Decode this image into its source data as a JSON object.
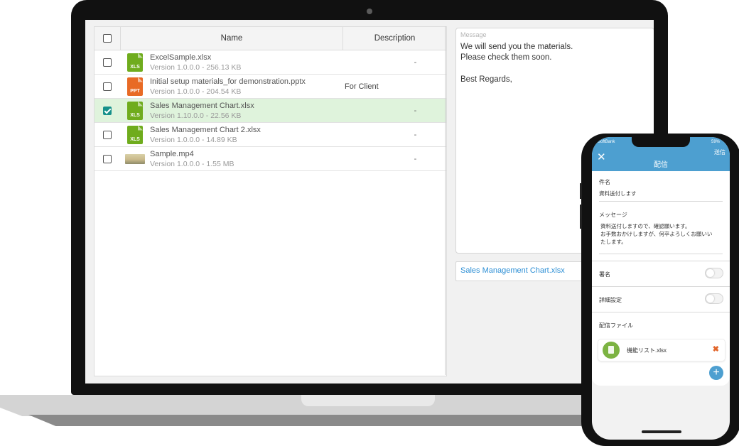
{
  "table": {
    "headers": {
      "name": "Name",
      "description": "Description"
    },
    "rows": [
      {
        "icon": "xls-file-icon",
        "icon_label": "XLS",
        "name": "ExcelSample.xlsx",
        "meta": "Version 1.0.0.0 - 256.13 KB",
        "description": "-",
        "checked": false
      },
      {
        "icon": "ppt-file-icon",
        "icon_label": "PPT",
        "name": "Initial setup materials_for demonstration.pptx",
        "meta": "Version 1.0.0.0 - 204.54 KB",
        "description": "For Client",
        "checked": false
      },
      {
        "icon": "xls-file-icon",
        "icon_label": "XLS",
        "name": "Sales Management Chart.xlsx",
        "meta": "Version 1.10.0.0 - 22.56 KB",
        "description": "-",
        "checked": true
      },
      {
        "icon": "xls-file-icon",
        "icon_label": "XLS",
        "name": "Sales Management Chart 2.xlsx",
        "meta": "Version 1.0.0.0 - 14.89 KB",
        "description": "-",
        "checked": false
      },
      {
        "icon": "video-thumbnail-icon",
        "icon_label": "",
        "name": "Sample.mp4",
        "meta": "Version 1.0.0.0 - 1.55 MB",
        "description": "-",
        "checked": false
      }
    ]
  },
  "message": {
    "label": "Message",
    "lines": [
      "We will send you the materials.",
      "Please check them soon.",
      "Best Regards,"
    ]
  },
  "attachment": {
    "filename": "Sales Management Chart.xlsx"
  },
  "phone": {
    "status": {
      "carrier": "SoftBank",
      "battery": "59%"
    },
    "send_label": "送信",
    "title": "配信",
    "subject_label": "件名",
    "subject_value": "資料送付します",
    "message_label": "メッセージ",
    "message_lines": [
      "資料送付しますので、確認願います。",
      "お手数おかけしますが、何卒よろしくお願いい",
      "たします。"
    ],
    "signature_label": "署名",
    "advanced_label": "詳細設定",
    "files_label": "配信ファイル",
    "file_name": "機能リスト.xlsx"
  },
  "colors": {
    "accent_blue": "#4d9fd0",
    "check_teal": "#16908a",
    "selected_row": "#dff3dc",
    "xls_green": "#6fac1d",
    "ppt_orange": "#e86a25",
    "link_blue": "#2d8fd5"
  }
}
